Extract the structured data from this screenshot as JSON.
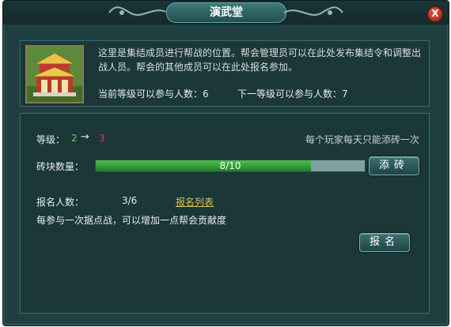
{
  "window": {
    "title": "演武堂",
    "close_label": "X"
  },
  "info": {
    "description": "这里是集结成员进行帮战的位置。帮会管理员可以在此处发布集结令和调整出战人员。帮会的其他成员可以在此处报名参加。",
    "current_level_capacity": "当前等级可以参与人数：6",
    "next_level_capacity": "下一等级可以参与人数：7"
  },
  "level": {
    "label": "等级：",
    "current": "2",
    "arrow": "→",
    "next": "3"
  },
  "daily_note": "每个玩家每天只能添砖一次",
  "bricks": {
    "label": "砖块数量：",
    "progress_text": "8/10",
    "progress": 0.8,
    "add_button": "添砖"
  },
  "signup": {
    "label": "报名人数：",
    "count": "3/6",
    "list_link": "报名列表",
    "bonus_note": "每参与一次据点战，可以增加一点帮会贡献度",
    "button": "报名"
  },
  "colors": {
    "accent_green": "#4ee04e",
    "accent_red": "#e03c3c",
    "link_gold": "#d9c25a",
    "panel_bg": "#1f3f40"
  },
  "icons": [
    "pavilion-building-icon",
    "close-icon",
    "title-ornament-icon"
  ]
}
